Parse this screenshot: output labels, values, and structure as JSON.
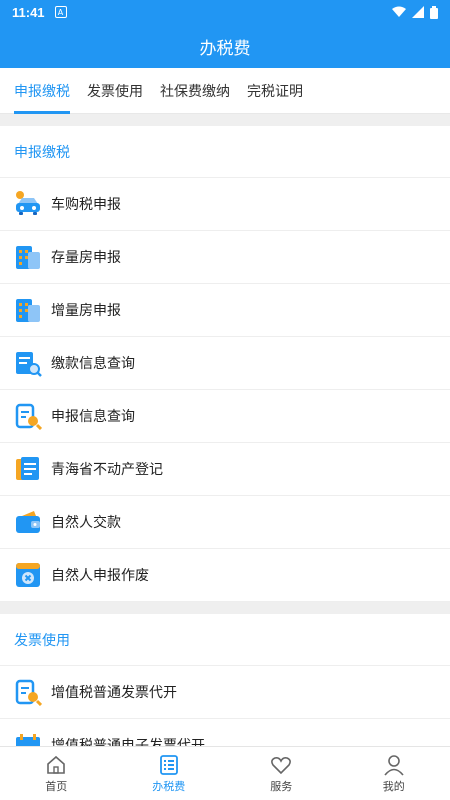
{
  "status": {
    "time": "11:41"
  },
  "header": {
    "title": "办税费"
  },
  "tabs": [
    {
      "label": "申报缴税"
    },
    {
      "label": "发票使用"
    },
    {
      "label": "社保费缴纳"
    },
    {
      "label": "完税证明"
    }
  ],
  "section1": {
    "title": "申报缴税",
    "items": [
      {
        "label": "车购税申报",
        "icon": "car-icon"
      },
      {
        "label": "存量房申报",
        "icon": "building-icon"
      },
      {
        "label": "增量房申报",
        "icon": "building-icon"
      },
      {
        "label": "缴款信息查询",
        "icon": "document-search-icon"
      },
      {
        "label": "申报信息查询",
        "icon": "document-search-icon"
      },
      {
        "label": "青海省不动产登记",
        "icon": "documents-icon"
      },
      {
        "label": "自然人交款",
        "icon": "wallet-icon"
      },
      {
        "label": "自然人申报作废",
        "icon": "cancel-form-icon"
      }
    ]
  },
  "section2": {
    "title": "发票使用",
    "items": [
      {
        "label": "增值税普通发票代开",
        "icon": "document-search-icon"
      },
      {
        "label": "增值税普通电子发票代开",
        "icon": "invoice-icon"
      }
    ]
  },
  "bottom_nav": [
    {
      "label": "首页",
      "icon": "home-icon"
    },
    {
      "label": "办税费",
      "icon": "list-icon"
    },
    {
      "label": "服务",
      "icon": "heart-icon"
    },
    {
      "label": "我的",
      "icon": "user-icon"
    }
  ],
  "colors": {
    "primary": "#2196f3",
    "accent_orange": "#f5a623"
  }
}
